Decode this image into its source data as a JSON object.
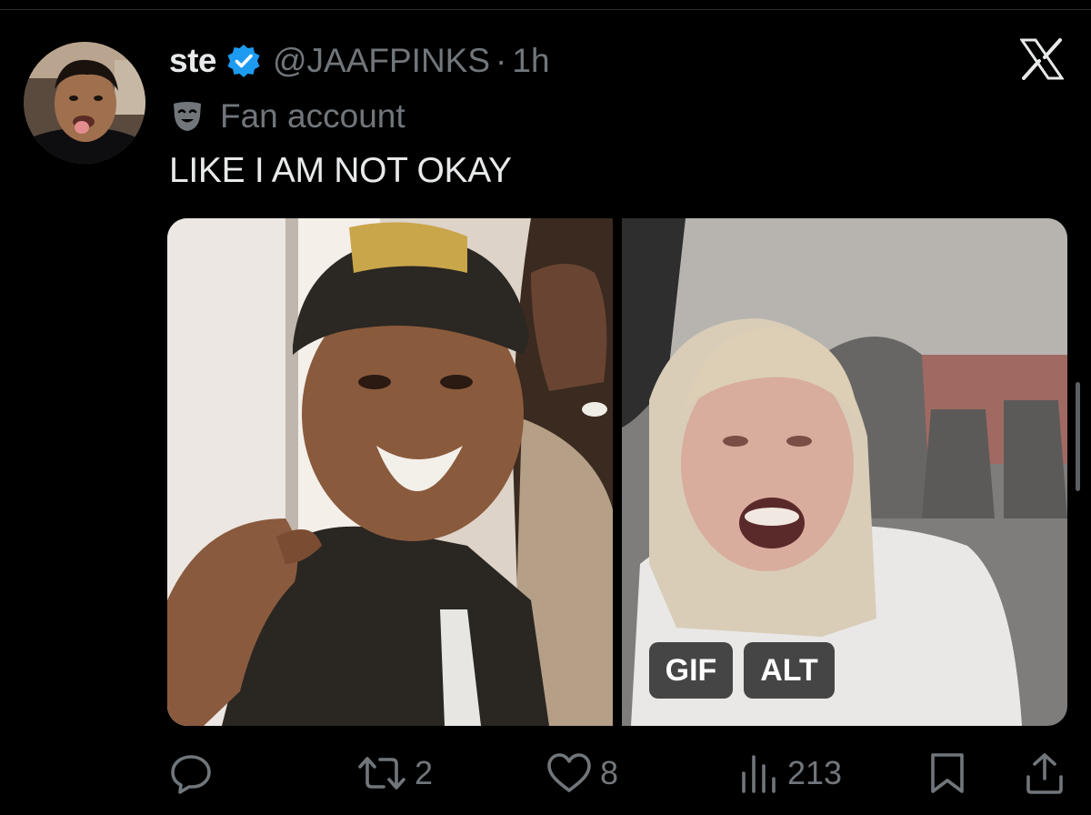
{
  "tweet": {
    "display_name": "ste",
    "handle": "@JAAFPINKS",
    "separator": "·",
    "time": "1h",
    "label": "Fan account",
    "text": "LIKE I AM NOT OKAY"
  },
  "media": {
    "badges": {
      "gif": "GIF",
      "alt": "ALT"
    }
  },
  "actions": {
    "reply_count": "",
    "retweet_count": "2",
    "like_count": "8",
    "view_count": "213"
  },
  "icons": {
    "verified": "verified-badge-icon",
    "label": "theater-mask-icon",
    "close": "x-logo-icon",
    "reply": "reply-icon",
    "retweet": "retweet-icon",
    "like": "heart-icon",
    "views": "views-icon",
    "bookmark": "bookmark-icon",
    "share": "share-icon"
  },
  "colors": {
    "background": "#000000",
    "text_primary": "#e7e9ea",
    "text_secondary": "#71767b",
    "verified_blue": "#1d9bf0"
  }
}
